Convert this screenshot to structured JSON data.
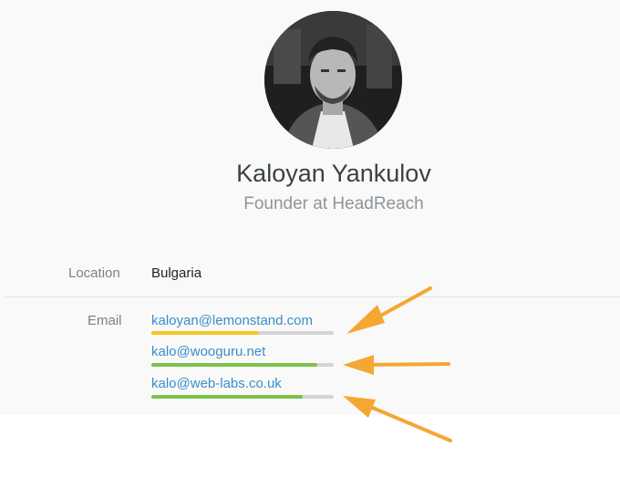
{
  "profile": {
    "name": "Kaloyan Yankulov",
    "title": "Founder at HeadReach"
  },
  "fields": {
    "location_label": "Location",
    "location_value": "Bulgaria",
    "email_label": "Email"
  },
  "emails": [
    {
      "address": "kaloyan@lemonstand.com",
      "confidence": 0.59,
      "color": "#f6c51f"
    },
    {
      "address": "kalo@wooguru.net",
      "confidence": 0.91,
      "color": "#7cc24a"
    },
    {
      "address": "kalo@web-labs.co.uk",
      "confidence": 0.83,
      "color": "#7cc24a"
    }
  ],
  "colors": {
    "link": "#3a8fc9",
    "arrow": "#f5a733",
    "track": "#d4d4d4"
  }
}
